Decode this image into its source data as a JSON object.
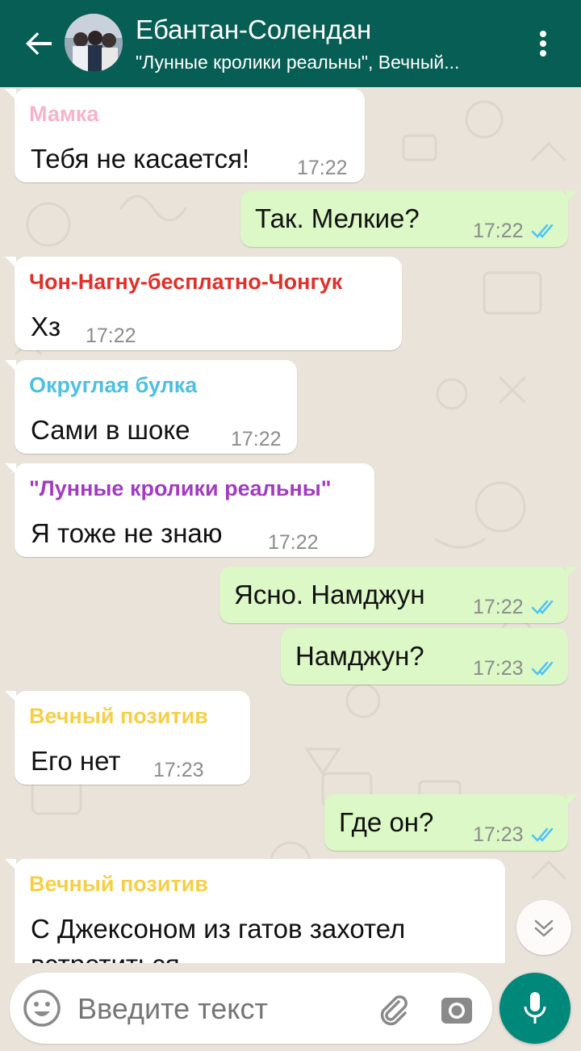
{
  "header": {
    "title": "Ебантан-Солендан",
    "subtitle": "\"Лунные кролики реальны\", Вечный..."
  },
  "messages": [
    {
      "direction": "in",
      "sender": "Мамка",
      "sender_color": "#f7b3c9",
      "text": "Тебя не касается!",
      "time": "17:22"
    },
    {
      "direction": "out",
      "text": "Так. Мелкие?",
      "time": "17:22",
      "status": "read"
    },
    {
      "direction": "in",
      "sender": "Чон-Нагну-бесплатно-Чонгук",
      "sender_color": "#e0302a",
      "text": "Хз",
      "time": "17:22"
    },
    {
      "direction": "in",
      "sender": "Округлая булка",
      "sender_color": "#4fc0e0",
      "text": "Сами в шоке",
      "time": "17:22"
    },
    {
      "direction": "in",
      "sender": "\"Лунные кролики реальны\"",
      "sender_color": "#a23cc0",
      "text": "Я тоже не знаю",
      "time": "17:22"
    },
    {
      "direction": "out",
      "text": "Ясно. Намджун",
      "time": "17:22",
      "status": "read"
    },
    {
      "direction": "out",
      "text": "Намджун?",
      "time": "17:23",
      "status": "read"
    },
    {
      "direction": "in",
      "sender": "Вечный позитив",
      "sender_color": "#f5cf4a",
      "text": "Его нет",
      "time": "17:23"
    },
    {
      "direction": "out",
      "text": "Где он?",
      "time": "17:23",
      "status": "read"
    },
    {
      "direction": "in",
      "sender": "Вечный позитив",
      "sender_color": "#f5cf4a",
      "text": "С Джексоном из гатов захотел встретиться",
      "text_line1": "С Джексоном из гатов захотел",
      "text_line2": "встретиться"
    }
  ],
  "input": {
    "placeholder": "Введите текст"
  },
  "colors": {
    "header_bg": "#075e54",
    "outgoing_bubble": "#dcf8c6",
    "incoming_bubble": "#ffffff",
    "read_ticks": "#4fc3f7",
    "mic_button": "#00897b"
  },
  "icons": [
    "back-arrow-icon",
    "more-vert-icon",
    "chevron-double-down-icon",
    "emoji-icon",
    "paperclip-icon",
    "camera-icon",
    "microphone-icon"
  ]
}
